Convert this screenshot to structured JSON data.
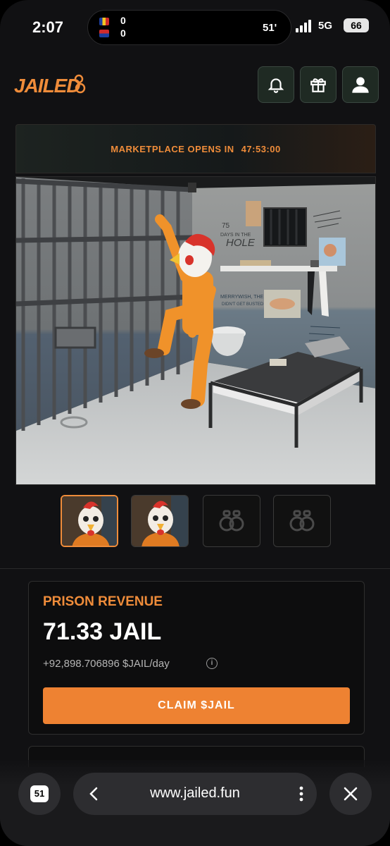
{
  "status_bar": {
    "time": "2:07",
    "live_activity": {
      "team1_score": "0",
      "team2_score": "0",
      "minute": "51'"
    },
    "network": "5G",
    "battery": "66"
  },
  "header": {
    "logo_text": "JAILED",
    "buttons": [
      {
        "icon": "bell-icon"
      },
      {
        "icon": "gift-icon"
      },
      {
        "icon": "user-icon"
      }
    ]
  },
  "banner": {
    "label": "MARKETPLACE OPENS IN",
    "timer": "47:53:00"
  },
  "scene": {
    "wall_text_1": "75 DAYS IN THE HOLE",
    "wall_text_2": "MERRYWISH, THE",
    "wall_text_3": "DIDN'T GET BUSTED"
  },
  "thumbnails": [
    {
      "type": "character",
      "selected": true
    },
    {
      "type": "character",
      "selected": false
    },
    {
      "type": "handcuffs-icon",
      "selected": false
    },
    {
      "type": "handcuffs-icon",
      "selected": false
    }
  ],
  "revenue": {
    "title": "PRISON REVENUE",
    "amount": "71.33 JAIL",
    "rate": "+92,898.706896 $JAIL/day",
    "claim_label": "CLAIM $JAIL"
  },
  "browser": {
    "tab_count": "51",
    "url": "www.jailed.fun"
  },
  "colors": {
    "accent": "#ee8232",
    "background": "#111113",
    "card": "#0d0d0e"
  }
}
